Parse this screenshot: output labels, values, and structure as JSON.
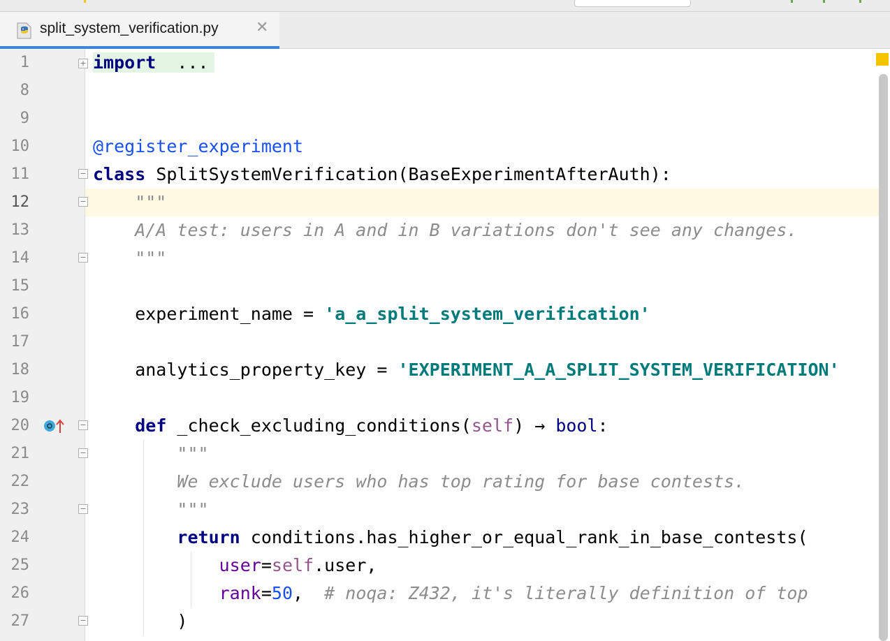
{
  "tab": {
    "filename": "split_system_verification.py",
    "close_glyph": "✕",
    "icon": "python-file-icon"
  },
  "editor": {
    "highlighted_line": "12",
    "line_numbers": [
      "1",
      "8",
      "9",
      "10",
      "11",
      "12",
      "13",
      "14",
      "15",
      "16",
      "17",
      "18",
      "19",
      "20",
      "21",
      "22",
      "23",
      "24",
      "25",
      "26",
      "27"
    ],
    "code": {
      "l1_kw": "import",
      "l1_rest": "  ...",
      "l10_deco": "@register_experiment",
      "l11_kw": "class",
      "l11_rest": " SplitSystemVerification(BaseExperimentAfterAuth):",
      "l12_doc": "    \"\"\"",
      "l13_doc": "    A/A test: users in A and in B variations don't see any changes.",
      "l14_doc": "    \"\"\"",
      "l16_name": "    experiment_name = ",
      "l16_str": "'a_a_split_system_verification'",
      "l18_name": "    analytics_property_key = ",
      "l18_str": "'EXPERIMENT_A_A_SPLIT_SYSTEM_VERIFICATION'",
      "l20_indent": "    ",
      "l20_kw": "def",
      "l20_name": " _check_excluding_conditions(",
      "l20_self": "self",
      "l20_arrow": ") → ",
      "l20_ret": "bool",
      "l20_colon": ":",
      "l21_doc": "        \"\"\"",
      "l22_doc": "        We exclude users who has top rating for base contests.",
      "l23_doc": "        \"\"\"",
      "l24_indent": "        ",
      "l24_kw": "return",
      "l24_rest": " conditions.has_higher_or_equal_rank_in_base_contests(",
      "l25_indent": "            ",
      "l25_kwarg": "user",
      "l25_eq": "=",
      "l25_self": "self",
      "l25_rest": ".user,",
      "l26_indent": "            ",
      "l26_kwarg": "rank",
      "l26_eq": "=",
      "l26_num": "50",
      "l26_comma": ",  ",
      "l26_comment": "# noqa: Z432, it's literally definition of top",
      "l27": "        )"
    }
  },
  "colors": {
    "keyword": "#000080",
    "string": "#007a7a",
    "docstring": "#8c8c8c",
    "self": "#94558d",
    "number": "#1750eb",
    "current_line": "#fdf9e3",
    "tab_underline": "#3d85d8",
    "warning_marker": "#f5c400"
  }
}
